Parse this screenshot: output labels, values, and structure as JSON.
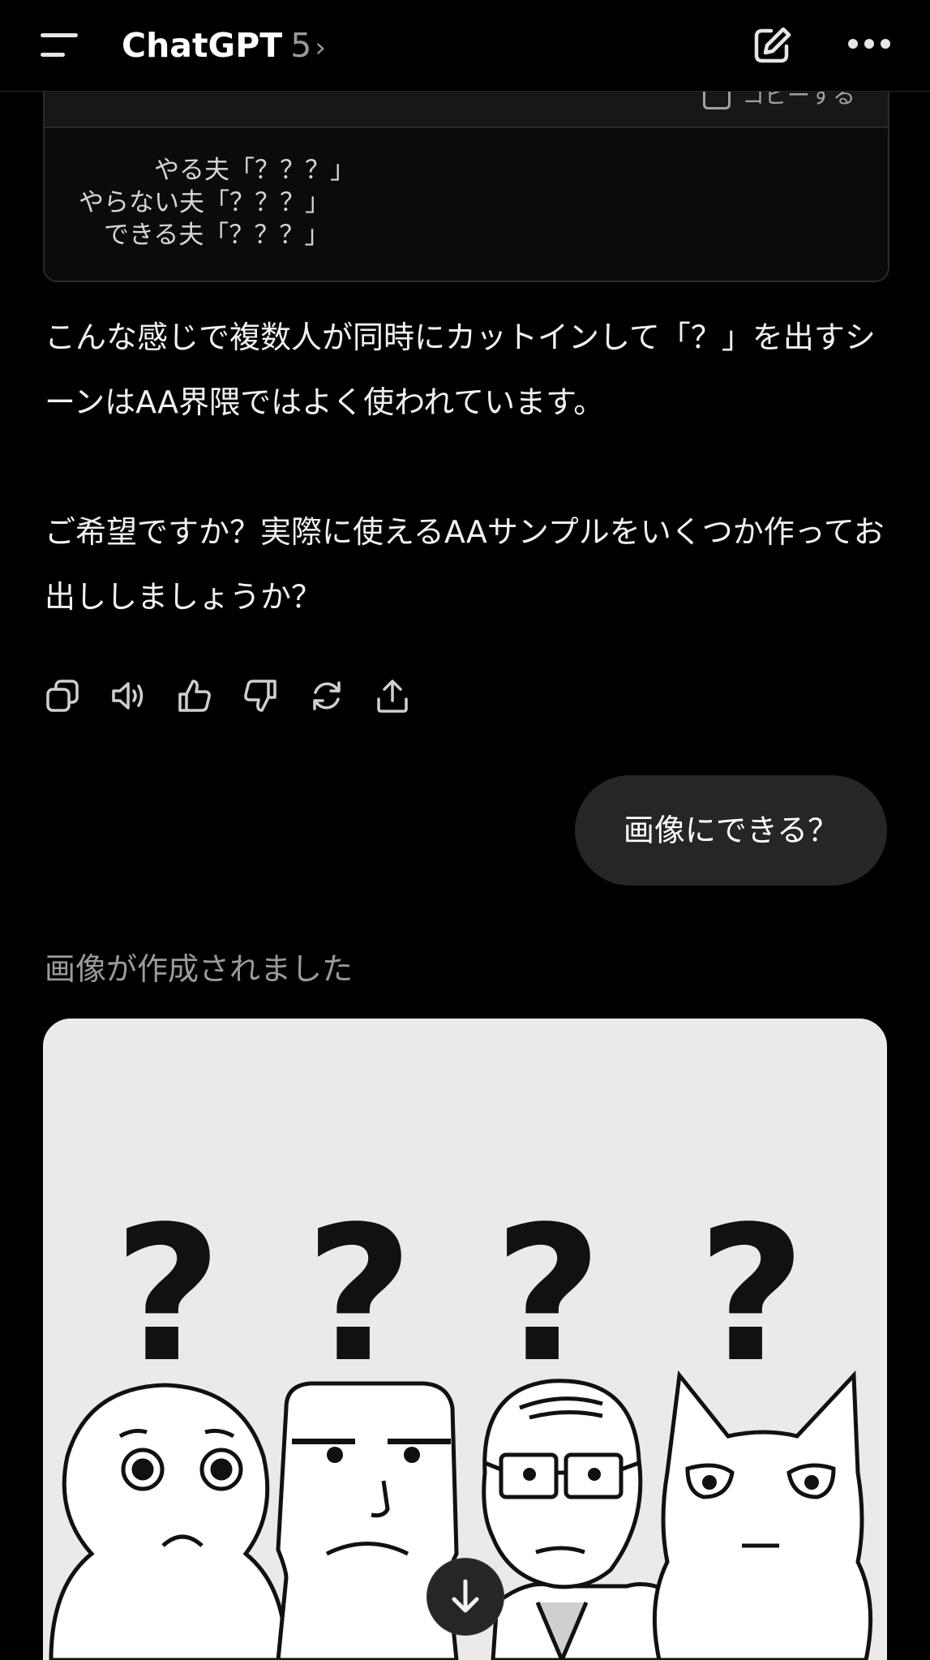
{
  "header": {
    "app_name": "ChatGPT",
    "model_version": "5",
    "chevron": "›",
    "icons": {
      "menu": "menu-icon",
      "new_chat": "edit-icon",
      "more": "more-icon"
    }
  },
  "code_block": {
    "copy_label": "コピーする",
    "lines": [
      "　　　やる夫「？？？」",
      "やらない夫「？？？」",
      "　できる夫「？？？」"
    ]
  },
  "assistant_message": {
    "paragraph1": "こんな感じで複数人が同時にカットインして「？」を出すシーンはAA界隈ではよく使われています。",
    "paragraph2": "ご希望ですか？実際に使えるAAサンプルをいくつか作ってお出ししましょうか？",
    "actions": [
      "copy-icon",
      "read-aloud-icon",
      "thumbs-up-icon",
      "thumbs-down-icon",
      "regenerate-icon",
      "share-icon"
    ]
  },
  "user_message": {
    "text": "画像にできる？"
  },
  "image_response": {
    "status": "画像が作成されました",
    "question_marks": [
      "?",
      "?",
      "?",
      "?"
    ],
    "background_color": "#eceae8"
  },
  "colors": {
    "background": "#000000",
    "bubble": "#262626",
    "muted_text": "#9b9b9b"
  }
}
